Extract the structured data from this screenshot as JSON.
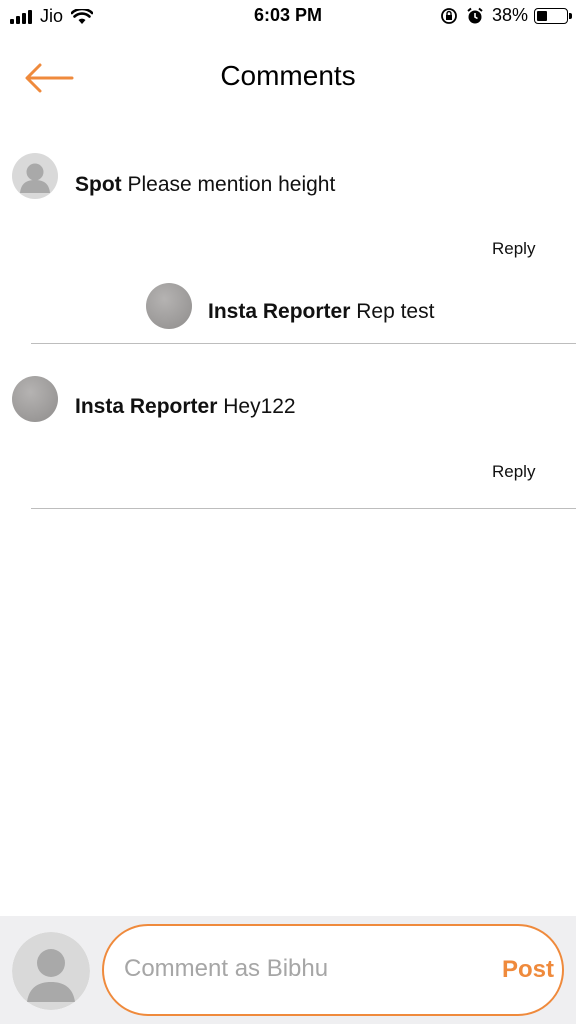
{
  "status_bar": {
    "carrier": "Jio",
    "time": "6:03 PM",
    "battery_percent": "38%",
    "battery_level": 0.38
  },
  "header": {
    "title": "Comments",
    "back_icon": "arrow-left-icon"
  },
  "colors": {
    "accent": "#ef8a3c",
    "divider": "#bdbdbd",
    "composer_bg": "#efeff1"
  },
  "comments": [
    {
      "author": "Spot",
      "text": "Please mention height",
      "reply_label": "Reply",
      "avatar": "default-user-icon",
      "replies": [
        {
          "author": "Insta Reporter",
          "text": "Rep test",
          "avatar": "photo"
        }
      ]
    },
    {
      "author": "Insta Reporter",
      "text": "Hey122",
      "reply_label": "Reply",
      "avatar": "photo",
      "replies": []
    }
  ],
  "composer": {
    "placeholder": "Comment as Bibhu",
    "post_label": "Post",
    "avatar": "default-user-icon"
  }
}
